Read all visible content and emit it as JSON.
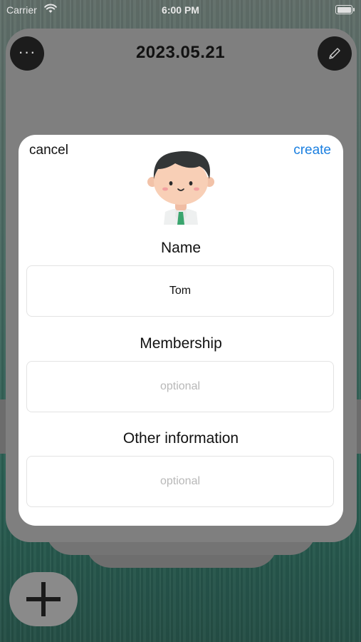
{
  "status_bar": {
    "carrier": "Carrier",
    "time": "6:00 PM"
  },
  "header": {
    "date": "2023.05.21",
    "menu_glyph": "···"
  },
  "modal": {
    "cancel_label": "cancel",
    "create_label": "create",
    "fields": [
      {
        "label": "Name",
        "value": "Tom",
        "placeholder": ""
      },
      {
        "label": "Membership",
        "value": "",
        "placeholder": "optional"
      },
      {
        "label": "Other information",
        "value": "",
        "placeholder": "optional"
      }
    ]
  },
  "icons": {
    "menu": "ellipsis-icon",
    "edit": "pencil-icon",
    "add": "plus-icon",
    "avatar": "person-avatar-icon"
  },
  "colors": {
    "accent": "#1a7fe0",
    "overlay": "#7f7f7f"
  }
}
